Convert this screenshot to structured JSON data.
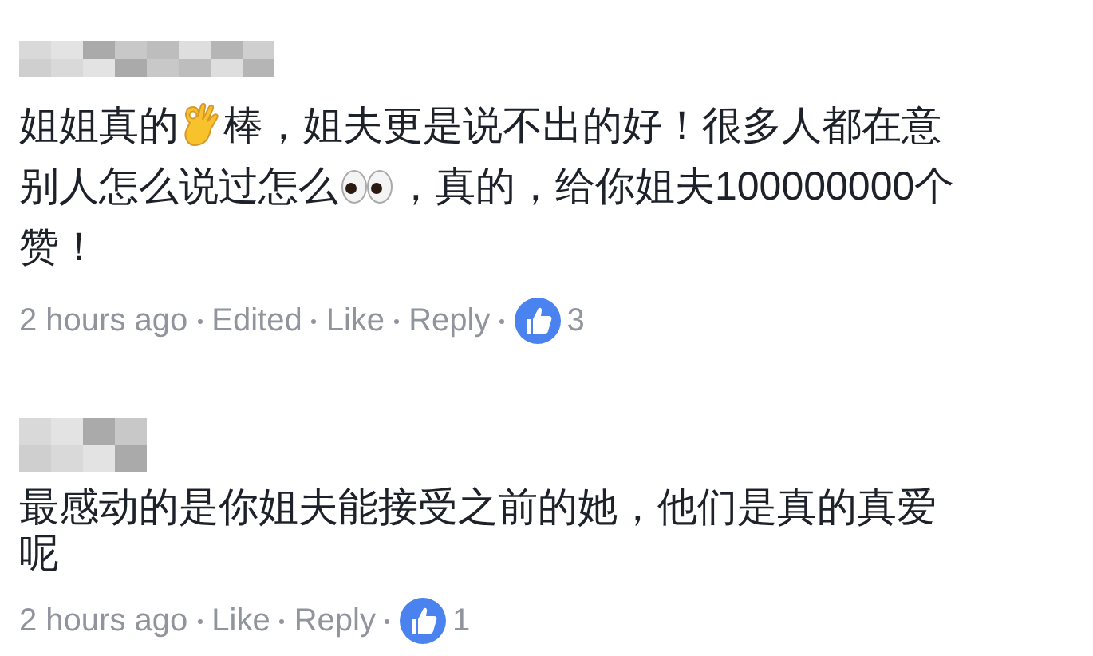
{
  "comments": [
    {
      "author_hidden": true,
      "message_lines": [
        [
          {
            "kind": "text",
            "text": "姐姐真的"
          },
          {
            "kind": "ok_hand"
          },
          {
            "kind": "text",
            "text": "棒，姐夫更是说不出的好！很多人都在意"
          }
        ],
        [
          {
            "kind": "text",
            "text": "别人怎么说过怎么"
          },
          {
            "kind": "eyes"
          },
          {
            "kind": "text",
            "text": "，真的，给你姐夫100000000个"
          }
        ],
        [
          {
            "kind": "text",
            "text": "赞！"
          }
        ]
      ],
      "meta": [
        "2 hours ago",
        "Edited",
        "Like",
        "Reply"
      ],
      "likes": "3"
    },
    {
      "author_hidden": true,
      "message_lines": [
        [
          {
            "kind": "text",
            "text": "最感动的是你姐夫能接受之前的她，他们是真的真爱"
          }
        ],
        [
          {
            "kind": "text",
            "text": "呢"
          }
        ]
      ],
      "meta": [
        "2 hours ago",
        "Like",
        "Reply"
      ],
      "likes": "1"
    }
  ]
}
